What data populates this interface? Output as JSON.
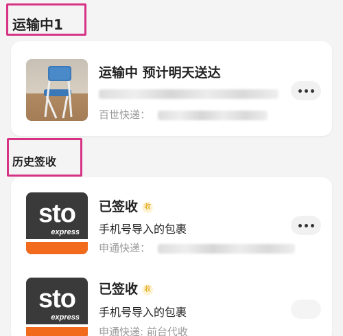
{
  "sections": {
    "in_transit_title": "运输中1",
    "history_title": "历史签收"
  },
  "in_transit": {
    "status": "运输中 预计明天送达",
    "courier_label": "百世快递："
  },
  "history": [
    {
      "status": "已签收",
      "badge": "收",
      "desc": "手机号导入的包裹",
      "courier_label": "申通快递："
    },
    {
      "status": "已签收",
      "badge": "收",
      "desc": "手机号导入的包裹",
      "courier_label": "申通快递: 前台代收"
    }
  ],
  "logo": {
    "word": "sto",
    "sub": "express"
  },
  "colors": {
    "highlight": "#d63384",
    "sto_orange": "#f26b1d"
  }
}
